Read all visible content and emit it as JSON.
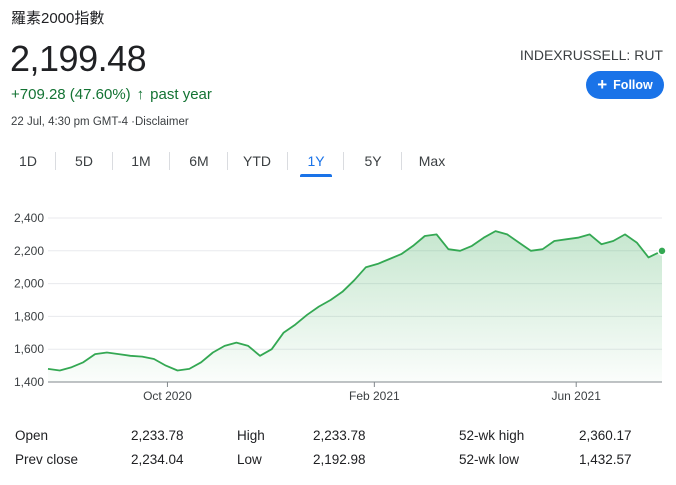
{
  "title": "羅素2000指數",
  "price": "2,199.48",
  "change": {
    "text": "+709.28 (47.60%)",
    "arrow": "↑",
    "period": "past year"
  },
  "meta": {
    "timestamp": "22 Jul, 4:30 pm GMT-4",
    "separator": " ·",
    "disclaimer": "Disclaimer"
  },
  "ticker": "INDEXRUSSELL: RUT",
  "follow": {
    "label": "Follow",
    "icon": "plus-icon"
  },
  "tabs": [
    {
      "label": "1D"
    },
    {
      "label": "5D"
    },
    {
      "label": "1M"
    },
    {
      "label": "6M"
    },
    {
      "label": "YTD"
    },
    {
      "label": "1Y",
      "active": true
    },
    {
      "label": "5Y"
    },
    {
      "label": "Max"
    }
  ],
  "colors": {
    "line": "#34a853",
    "positive": "#137333",
    "accent": "#1a73e8"
  },
  "chart_data": {
    "type": "area",
    "xlabels": [
      "Oct 2020",
      "Feb 2021",
      "Jun 2021"
    ],
    "yticks": [
      "1,400",
      "1,600",
      "1,800",
      "2,000",
      "2,200",
      "2,400"
    ],
    "ylim": [
      1400,
      2400
    ],
    "grid": true,
    "x": [
      "2020-07-22",
      "2020-07-29",
      "2020-08-05",
      "2020-08-12",
      "2020-08-19",
      "2020-08-26",
      "2020-09-02",
      "2020-09-09",
      "2020-09-16",
      "2020-09-23",
      "2020-09-30",
      "2020-10-07",
      "2020-10-14",
      "2020-10-21",
      "2020-10-28",
      "2020-11-04",
      "2020-11-11",
      "2020-11-18",
      "2020-11-25",
      "2020-12-02",
      "2020-12-09",
      "2020-12-16",
      "2020-12-23",
      "2020-12-30",
      "2021-01-06",
      "2021-01-13",
      "2021-01-20",
      "2021-01-27",
      "2021-02-03",
      "2021-02-10",
      "2021-02-17",
      "2021-02-24",
      "2021-03-03",
      "2021-03-10",
      "2021-03-17",
      "2021-03-24",
      "2021-03-31",
      "2021-04-07",
      "2021-04-14",
      "2021-04-21",
      "2021-04-28",
      "2021-05-05",
      "2021-05-12",
      "2021-05-19",
      "2021-05-26",
      "2021-06-02",
      "2021-06-09",
      "2021-06-16",
      "2021-06-23",
      "2021-06-30",
      "2021-07-07",
      "2021-07-14",
      "2021-07-22"
    ],
    "values": [
      1480,
      1470,
      1490,
      1520,
      1570,
      1580,
      1570,
      1560,
      1555,
      1540,
      1500,
      1470,
      1480,
      1520,
      1580,
      1620,
      1640,
      1620,
      1560,
      1600,
      1700,
      1750,
      1810,
      1860,
      1900,
      1950,
      2020,
      2100,
      2120,
      2150,
      2180,
      2230,
      2290,
      2300,
      2210,
      2200,
      2230,
      2280,
      2320,
      2300,
      2250,
      2200,
      2210,
      2260,
      2270,
      2280,
      2300,
      2240,
      2260,
      2300,
      2250,
      2160,
      2199.48
    ]
  },
  "stats": [
    {
      "label": "Open",
      "value": "2,233.78"
    },
    {
      "label": "High",
      "value": "2,233.78"
    },
    {
      "label": "52-wk high",
      "value": "2,360.17"
    },
    {
      "label": "Prev close",
      "value": "2,234.04"
    },
    {
      "label": "Low",
      "value": "2,192.98"
    },
    {
      "label": "52-wk low",
      "value": "1,432.57"
    }
  ]
}
